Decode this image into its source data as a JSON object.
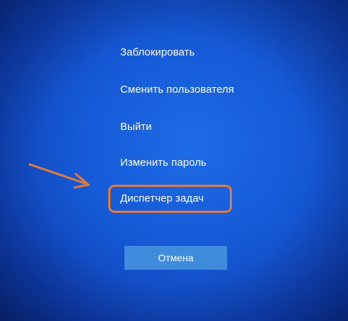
{
  "menu": {
    "items": [
      {
        "label": "Заблокировать"
      },
      {
        "label": "Сменить пользователя"
      },
      {
        "label": "Выйти"
      },
      {
        "label": "Изменить пароль"
      },
      {
        "label": "Диспетчер задач"
      }
    ]
  },
  "cancel_button": {
    "label": "Отмена"
  },
  "annotation": {
    "highlighted_item": "Диспетчер задач",
    "color": "#e87a35"
  },
  "colors": {
    "background": "#1558d4",
    "button": "#3f8bdc",
    "text": "#ffffff"
  }
}
